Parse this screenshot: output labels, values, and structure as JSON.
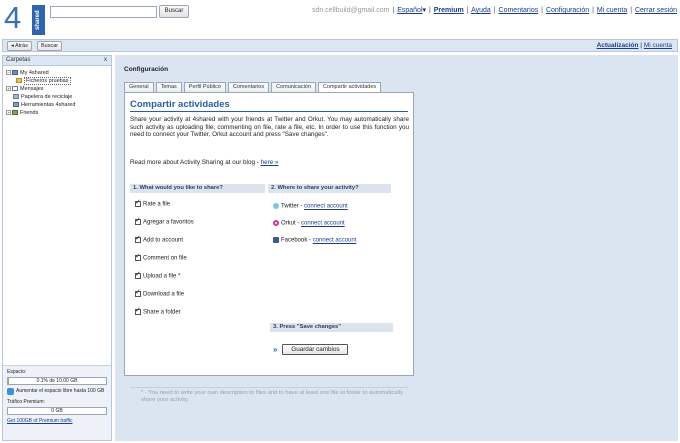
{
  "header": {
    "logo_number": "4",
    "logo_tag": "shared",
    "search_placeholder": "",
    "search_button": "Buscar",
    "email": "sdn.cellbuild@gmail.com",
    "links": [
      "Español",
      "Premium",
      "Ayuda",
      "Comentarios",
      "Configuración",
      "Mi cuenta",
      "Cerrar sesión"
    ]
  },
  "nav": {
    "back": "◂ Atrás",
    "search": "Buscar",
    "update": "Actualización",
    "account": "Mi cuenta"
  },
  "sidebar": {
    "title": "Carpetas",
    "close": "x",
    "items": [
      {
        "label": "My 4shared"
      },
      {
        "label": "Ficheros pruebas"
      },
      {
        "label": "Mensajes"
      },
      {
        "label": "Papelera de reciclaje"
      },
      {
        "label": "Herramientas 4shared"
      },
      {
        "label": "Friends"
      }
    ],
    "space_label": "Espacio:",
    "space_value": "0.1% de 10.00 GB",
    "space_fraction": 0.001,
    "upgrade_text": "Aumentar el espacio libre hasta 100 GB",
    "traffic_label": "Tráfico Premium:",
    "traffic_value": "0 GB",
    "traffic_link": "Get 100GB of Premium traffic"
  },
  "main": {
    "title": "Configuración",
    "tabs": [
      "General",
      "Temas",
      "Perfil Público",
      "Comentarios",
      "Comunicación",
      "Compartir actividades"
    ],
    "active_tab": 5,
    "panel_title": "Compartir actividades",
    "intro": "Share your activity at 4shared with your friends at Twitter and Orkut. You may automatically share such activity as uploading file, commenting on file, rate a file, etc. In order to use this function you need to connect your Twitter, Orkut account and press \"Save changes\".",
    "readmore_text": "Read more about Activity Sharing at our blog - ",
    "readmore_link": "here »",
    "section1": "1. What would you like to share?",
    "section2": "2. Where to share your activity?",
    "section3": "3. Press \"Save changes\"",
    "options": [
      "Rate a file",
      "Agregar a favoritos",
      "Add to account",
      "Comment on file",
      "Upload a file *",
      "Download a file",
      "Share a folder"
    ],
    "services": [
      {
        "name": "Twitter",
        "icon": "twitter-icon",
        "action": "connect account"
      },
      {
        "name": "Orkut",
        "icon": "orkut-icon",
        "action": "connect account"
      },
      {
        "name": "Facebook",
        "icon": "facebook-icon",
        "action": "connect account"
      }
    ],
    "service_sep": " - ",
    "save_arrows": "»",
    "save_button": "Guardar cambios",
    "footnote": "* - You need to write your own description to files and to have at least one file at folder to automatically share your activity."
  },
  "colors": {
    "accent": "#2a5ca8",
    "panel_bg": "#dbe4f1",
    "link": "#1a3d8f"
  }
}
